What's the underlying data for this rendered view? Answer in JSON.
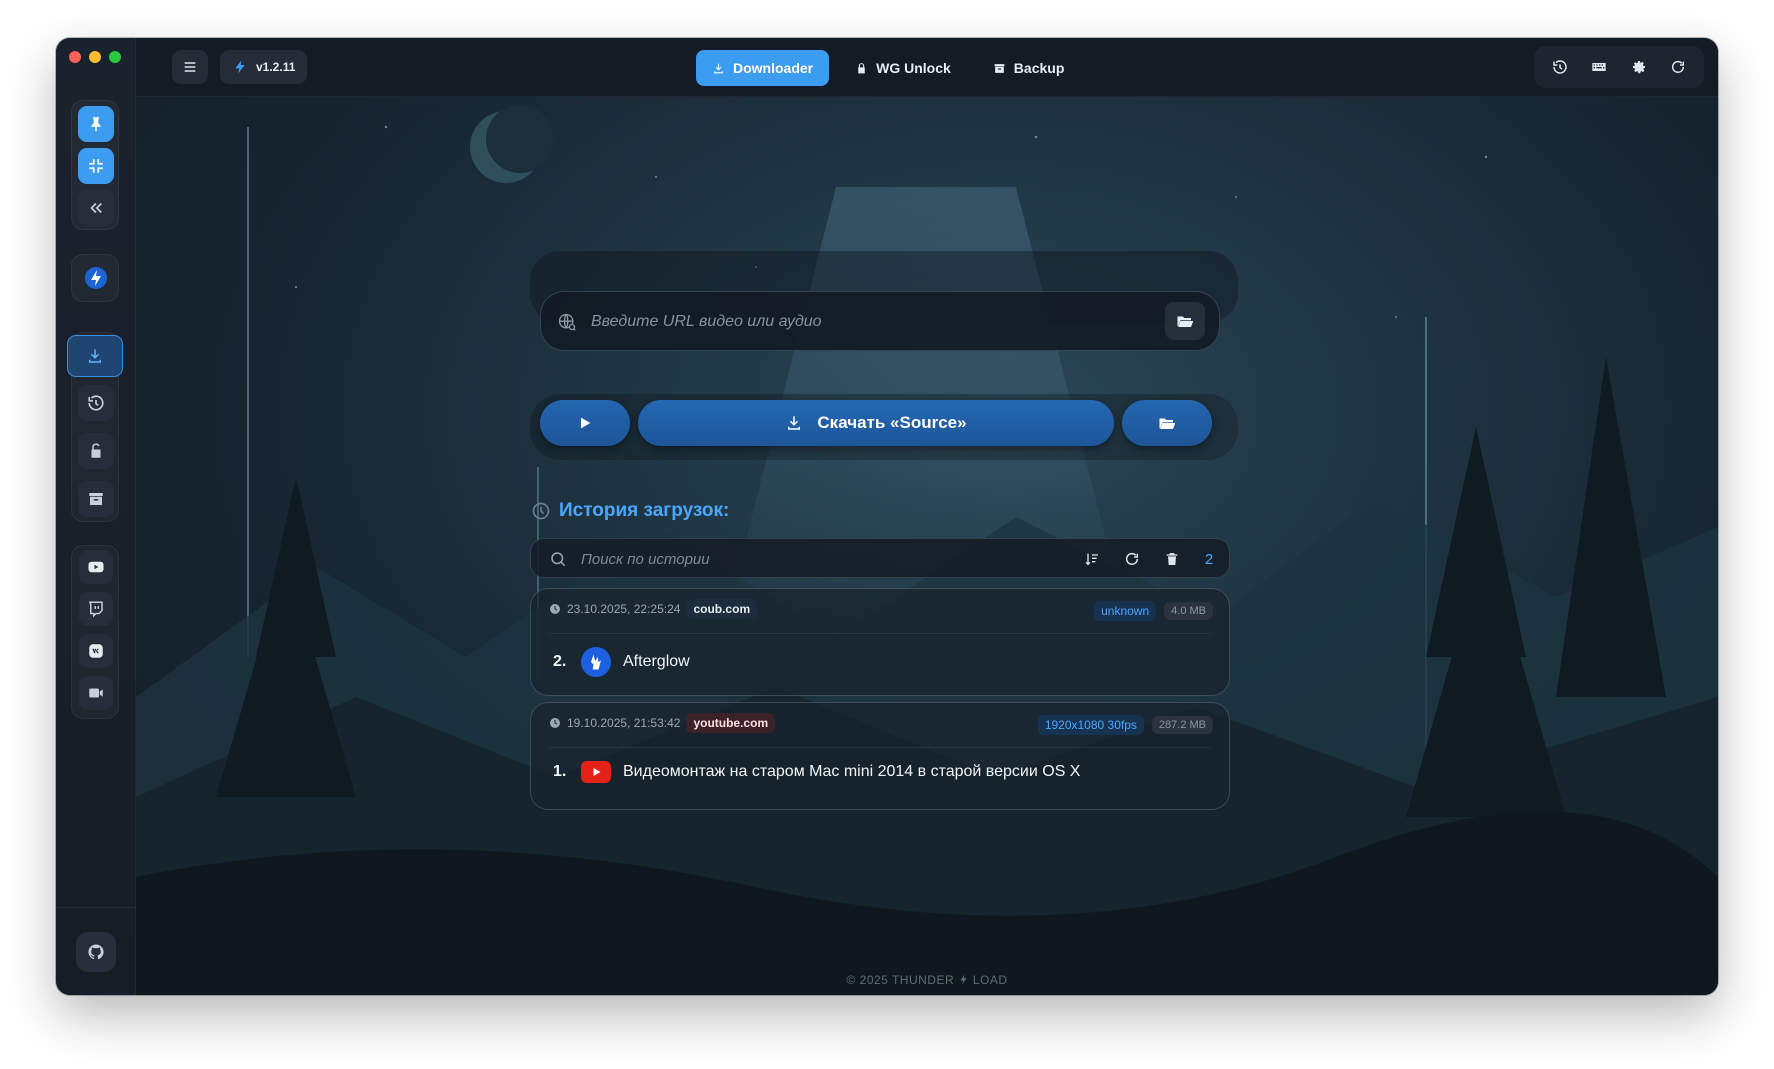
{
  "window": {
    "version": "v1.2.11"
  },
  "tabs": [
    {
      "label": "Downloader",
      "active": true,
      "icon": "download-icon"
    },
    {
      "label": "WG Unlock",
      "active": false,
      "icon": "lock-icon"
    },
    {
      "label": "Backup",
      "active": false,
      "icon": "archive-icon"
    }
  ],
  "toolbar_icons": [
    "history-icon",
    "keyboard-icon",
    "gear-icon",
    "refresh-icon"
  ],
  "sidebar": {
    "top": [
      "pin-icon",
      "compress-icon",
      "collapse-icon",
      "thunder-logo-icon"
    ],
    "nav": [
      "download-icon",
      "history-icon",
      "unlock-icon",
      "archive-icon"
    ],
    "services": [
      "youtube-icon",
      "twitch-icon",
      "vk-icon",
      "video-camera-icon"
    ],
    "footer": "github-icon"
  },
  "url": {
    "placeholder": "Введите URL видео или аудио",
    "value": ""
  },
  "download_button": {
    "label": "Скачать «Source»"
  },
  "history": {
    "title": "История загрузок:",
    "search_placeholder": "Поиск по истории",
    "count": "2",
    "items": [
      {
        "datetime": "23.10.2025, 22:25:24",
        "site": "coub.com",
        "quality": "unknown",
        "size": "4.0 MB",
        "index": "2.",
        "title": "Afterglow"
      },
      {
        "datetime": "19.10.2025, 21:53:42",
        "site": "youtube.com",
        "quality": "1920x1080 30fps",
        "size": "287.2 MB",
        "index": "1.",
        "title": "Видеомонтаж на старом Mac mini 2014 в старой версии OS X"
      }
    ]
  },
  "footer": {
    "copyright": "© 2025 THUNDER",
    "brand": "LOAD"
  },
  "colors": {
    "accent": "#3b9cf0",
    "history_title": "#4aa6ff",
    "youtube": "#e62117"
  }
}
